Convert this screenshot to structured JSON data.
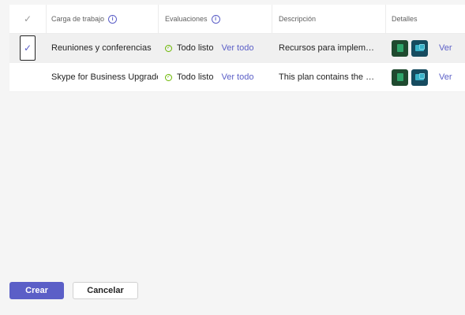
{
  "table": {
    "headers": {
      "select_mark": "✓",
      "workload": "Carga de trabajo",
      "evaluations": "Evaluaciones",
      "description": "Descripción",
      "details": "Detalles"
    },
    "rows": [
      {
        "selected": true,
        "check_mark": "✓",
        "workload": "Reuniones y conferencias",
        "status": "Todo listo",
        "view_all": "Ver todo",
        "description": "Recursos para implementación de reuniones y conferencias",
        "details_link": "Ver",
        "icons": [
          "planner-icon",
          "teams-app-icon"
        ]
      },
      {
        "selected": false,
        "check_mark": "",
        "workload": "Skype for Business Upgrade",
        "status": "Todo listo",
        "view_all": "Ver todo",
        "description": "This plan contains the steps",
        "details_link": "Ver",
        "icons": [
          "planner-icon",
          "teams-app-icon"
        ]
      }
    ]
  },
  "buttons": {
    "create": "Crear",
    "cancel": "Cancelar"
  },
  "colors": {
    "accent": "#5b5fc7",
    "status_ok": "#6bb700"
  }
}
